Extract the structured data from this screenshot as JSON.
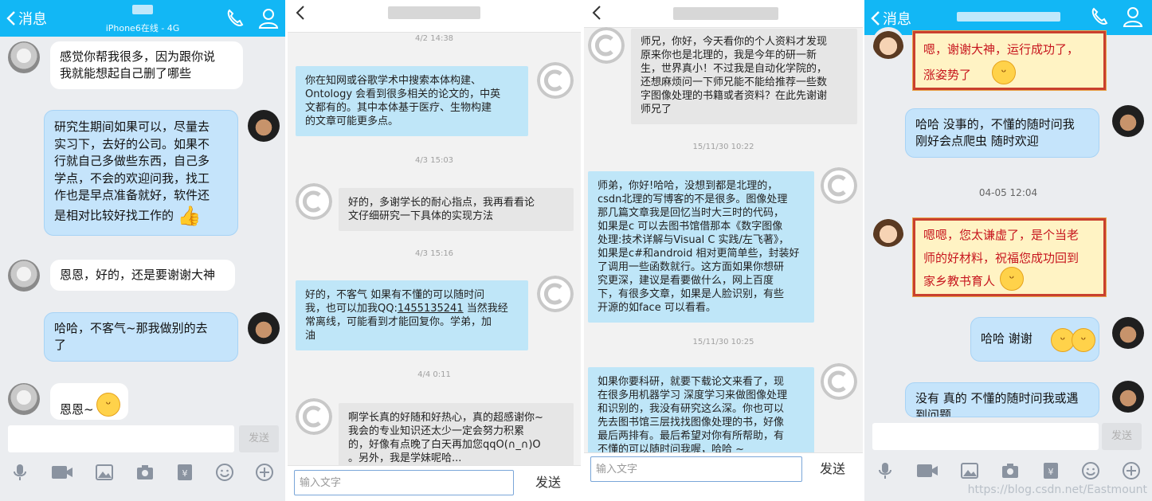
{
  "panel1": {
    "back_label": "消息",
    "subtitle": "iPhone6在线 - 4G",
    "messages": [
      {
        "from": "other",
        "text": "感觉你帮我很多，因为跟你说\n我就能想起自己删了哪些"
      },
      {
        "from": "me",
        "text": "研究生期间如果可以，尽量去\n实习下，去好的公司。如果不\n行就自己多做些东西，自己多\n学点，不会的欢迎问我，找工\n作也是早点准备就好，软件还\n是相对比较好找工作的"
      },
      {
        "from": "other",
        "text": "恩恩，好的，还是要谢谢大神"
      },
      {
        "from": "me",
        "text": "哈哈，不客气~那我做别的去\n了"
      },
      {
        "from": "other",
        "text": "恩恩~"
      }
    ],
    "send_label": "发送"
  },
  "panel2": {
    "input_placeholder": "输入文字",
    "send_label": "发送",
    "items": [
      {
        "kind": "time",
        "text": "4/2 14:38"
      },
      {
        "kind": "msg",
        "from": "other",
        "text": "你在知网或谷歌学术中搜索本体构建、\nOntology 会看到很多相关的论文的，中英\n文都有的。其中本体基于医疗、生物构建\n的文章可能更多点。"
      },
      {
        "kind": "time",
        "text": "4/3 15:03"
      },
      {
        "kind": "msg",
        "from": "me",
        "text": "好的，多谢学长的耐心指点，我再看看论\n文仔细研究一下具体的实现方法"
      },
      {
        "kind": "time",
        "text": "4/3 15:16"
      },
      {
        "kind": "msg",
        "from": "other",
        "text_before": "好的，不客气 如果有不懂的可以随时问\n我，也可以加我QQ:",
        "qq_number": "1455135241",
        "text_after": " 当然我经\n常离线，可能看到才能回复你。学弟，加\n油"
      },
      {
        "kind": "time",
        "text": "4/4 0:11"
      },
      {
        "kind": "msg",
        "from": "me",
        "text": "啊学长真的好随和好热心，真的超感谢你~\n我会的专业知识还太少一定会努力积累\n的，好像有点晚了白天再加您qqO(∩_∩)O\n。另外，我是学妹呢哈..."
      }
    ]
  },
  "panel3": {
    "input_placeholder": "输入文字",
    "send_label": "发送",
    "items": [
      {
        "kind": "msg",
        "from": "me",
        "text": "师兄，你好，今天看你的个人资料才发现\n原来你也是北理的，我是今年的研一新\n生，世界真小！不过我是自动化学院的，\n还想麻烦问一下师兄能不能给推荐一些数\n字图像处理的书籍或者资料？在此先谢谢\n师兄了"
      },
      {
        "kind": "time",
        "text": "15/11/30 10:22"
      },
      {
        "kind": "msg",
        "from": "other",
        "text": "师弟，你好!哈哈，没想到都是北理的，\ncsdn北理的写博客的不是很多。图像处理\n那几篇文章我是回忆当时大三时的代码，\n如果是c 可以去图书馆借那本《数字图像\n处理:技术详解与Visual C 实践/左飞著》，\n如果是c#和android 相对更简单些，封装好\n了调用一些函数就行。这方面如果你想研\n究更深，建议是看要做什么，网上百度\n下，有很多文章，如果是人脸识别，有些\n开源的如face 可以看看。"
      },
      {
        "kind": "time",
        "text": "15/11/30 10:25"
      },
      {
        "kind": "msg",
        "from": "other",
        "text": "如果你要科研，就要下载论文来看了，现\n在很多用机器学习 深度学习来做图像处理\n和识别的，我没有研究这么深。你也可以\n先去图书馆三层找找图像处理的书，好像\n最后两排有。最后希望对你有所帮助，有\n不懂的可以随时问我喔，哈哈 ~"
      }
    ]
  },
  "panel4": {
    "back_label": "消息",
    "time_label": "04-05 12:04",
    "messages": [
      {
        "from": "other",
        "text": "嗯，谢谢大神，运行成功了，\n涨姿势了"
      },
      {
        "from": "me",
        "text": "哈哈 没事的，不懂的随时问我\n刚好会点爬虫 随时欢迎"
      },
      {
        "from": "other",
        "text": "嗯嗯，您太谦虚了，是个当老\n师的好材料，祝福您成功回到\n家乡教书育人"
      },
      {
        "from": "me",
        "text": "哈哈 谢谢"
      },
      {
        "from": "me",
        "text": "没有 真的 不懂的随时问我或遇\n到问题"
      }
    ],
    "send_label": "发送",
    "watermark": "https://blog.csdn.net/Eastmount"
  },
  "colors": {
    "qq_header": "#12b7f5",
    "qq_blue_bubble": "#c5e4fb",
    "red_frame": "#c9402e",
    "square_blue": "#bfe6f8",
    "square_grey": "#e6e6e6"
  },
  "icons": [
    "chevron-left-icon",
    "phone-icon",
    "contact-icon",
    "microphone-icon",
    "video-icon",
    "image-icon",
    "camera-icon",
    "red-packet-icon",
    "smiley-icon",
    "plus-icon",
    "c-logo-avatar"
  ]
}
